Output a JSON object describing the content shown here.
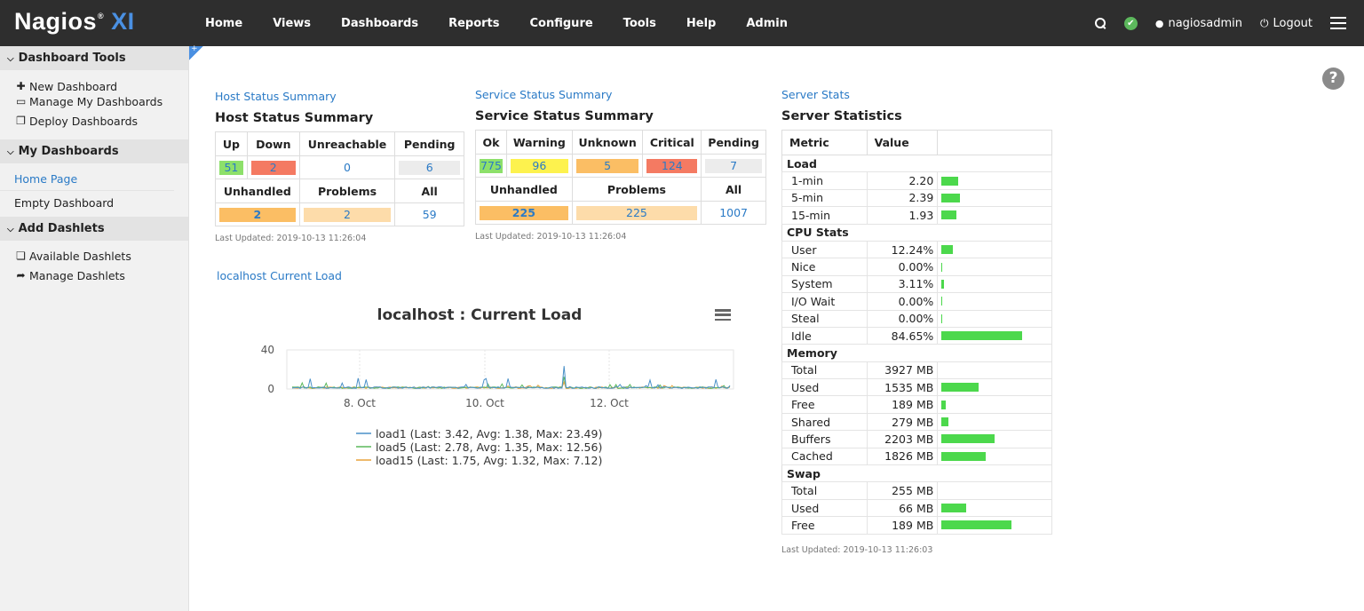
{
  "header": {
    "logo_main": "Nagios",
    "logo_reg": "®",
    "logo_xi": "XI",
    "nav": [
      "Home",
      "Views",
      "Dashboards",
      "Reports",
      "Configure",
      "Tools",
      "Help",
      "Admin"
    ],
    "user": "nagiosadmin",
    "logout": "Logout",
    "status_color": "#5cb85c"
  },
  "sidebar": {
    "tools_title": "Dashboard Tools",
    "tools": [
      {
        "icon": "plus-icon",
        "label": "New Dashboard"
      },
      {
        "icon": "window-icon",
        "label": "Manage My Dashboards"
      },
      {
        "icon": "copy-icon",
        "label": "Deploy Dashboards"
      }
    ],
    "my_title": "My Dashboards",
    "my": [
      "Home Page",
      "Empty Dashboard"
    ],
    "add_title": "Add Dashlets",
    "add": [
      {
        "icon": "stack-icon",
        "label": "Available Dashlets"
      },
      {
        "icon": "share-icon",
        "label": "Manage Dashlets"
      }
    ]
  },
  "host_status": {
    "link": "Host Status Summary",
    "title": "Host Status Summary",
    "headers": [
      "Up",
      "Down",
      "Unreachable",
      "Pending"
    ],
    "values": [
      "51",
      "2",
      "0",
      "6"
    ],
    "headers2": [
      "Unhandled",
      "Problems",
      "All"
    ],
    "values2": [
      "2",
      "2",
      "59"
    ],
    "updated": "Last Updated: 2019-10-13 11:26:04"
  },
  "service_status": {
    "link": "Service Status Summary",
    "title": "Service Status Summary",
    "headers": [
      "Ok",
      "Warning",
      "Unknown",
      "Critical",
      "Pending"
    ],
    "values": [
      "775",
      "96",
      "5",
      "124",
      "7"
    ],
    "headers2": [
      "Unhandled",
      "Problems",
      "All"
    ],
    "values2": [
      "225",
      "225",
      "1007"
    ],
    "updated": "Last Updated: 2019-10-13 11:26:04"
  },
  "server_stats": {
    "link": "Server Stats",
    "title": "Server Statistics",
    "col_metric": "Metric",
    "col_value": "Value",
    "sections": [
      {
        "name": "Load",
        "rows": [
          {
            "m": "1-min",
            "v": "2.20",
            "frac": 0.18
          },
          {
            "m": "5-min",
            "v": "2.39",
            "frac": 0.2
          },
          {
            "m": "15-min",
            "v": "1.93",
            "frac": 0.16
          }
        ]
      },
      {
        "name": "CPU Stats",
        "rows": [
          {
            "m": "User",
            "v": "12.24%",
            "frac": 0.1224
          },
          {
            "m": "Nice",
            "v": "0.00%",
            "frac": 0.0
          },
          {
            "m": "System",
            "v": "3.11%",
            "frac": 0.0311
          },
          {
            "m": "I/O Wait",
            "v": "0.00%",
            "frac": 0.0
          },
          {
            "m": "Steal",
            "v": "0.00%",
            "frac": 0.0
          },
          {
            "m": "Idle",
            "v": "84.65%",
            "frac": 0.8465
          }
        ]
      },
      {
        "name": "Memory",
        "rows": [
          {
            "m": "Total",
            "v": "3927 MB",
            "frac": null
          },
          {
            "m": "Used",
            "v": "1535 MB",
            "frac": 0.39
          },
          {
            "m": "Free",
            "v": "189 MB",
            "frac": 0.048
          },
          {
            "m": "Shared",
            "v": "279 MB",
            "frac": 0.071
          },
          {
            "m": "Buffers",
            "v": "2203 MB",
            "frac": 0.56
          },
          {
            "m": "Cached",
            "v": "1826 MB",
            "frac": 0.465
          }
        ]
      },
      {
        "name": "Swap",
        "rows": [
          {
            "m": "Total",
            "v": "255 MB",
            "frac": null
          },
          {
            "m": "Used",
            "v": "66 MB",
            "frac": 0.26
          },
          {
            "m": "Free",
            "v": "189 MB",
            "frac": 0.74
          }
        ]
      }
    ],
    "updated": "Last Updated: 2019-10-13 11:26:03"
  },
  "load_chart": {
    "link": "localhost Current Load",
    "menu_icon": "hamburger-icon"
  },
  "chart_data": {
    "type": "line",
    "title": "localhost : Current Load",
    "xlabel": "",
    "ylabel": "",
    "x_ticks": [
      "8. Oct",
      "10. Oct",
      "12. Oct"
    ],
    "y_ticks": [
      "0",
      "40"
    ],
    "ylim": [
      0,
      40
    ],
    "series": [
      {
        "name": "load1",
        "color": "#4a90c8",
        "legend": "load1 (Last: 3.42, Avg: 1.38, Max: 23.49)",
        "last": 3.42,
        "avg": 1.38,
        "max": 23.49
      },
      {
        "name": "load5",
        "color": "#5cb85c",
        "legend": "load5 (Last: 2.78, Avg: 1.35, Max: 12.56)",
        "last": 2.78,
        "avg": 1.35,
        "max": 12.56
      },
      {
        "name": "load15",
        "color": "#e8a33c",
        "legend": "load15 (Last: 1.75, Avg: 1.32, Max: 7.12)",
        "last": 1.75,
        "avg": 1.32,
        "max": 7.12
      }
    ]
  }
}
